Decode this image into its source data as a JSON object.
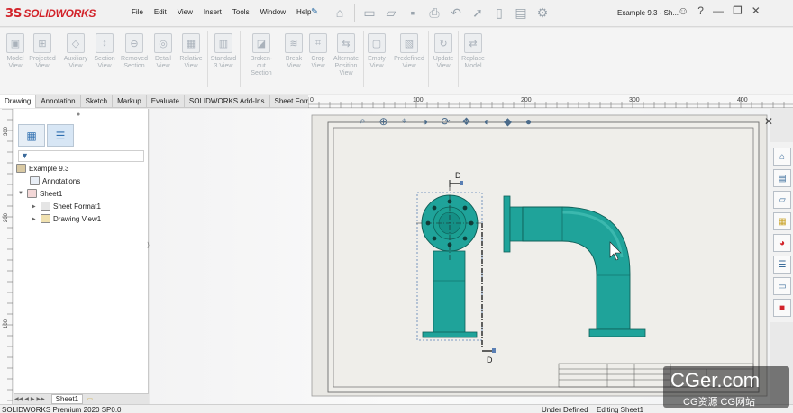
{
  "app": {
    "logo_mark": "3S",
    "logo_text": "SOLIDWORKS",
    "menus": [
      "File",
      "Edit",
      "View",
      "Insert",
      "Tools",
      "Window",
      "Help"
    ],
    "document_title": "Example 9.3 - Sh...",
    "quick_access_icons": [
      "home-icon",
      "new-icon",
      "open-icon",
      "save-icon",
      "print-icon",
      "undo-icon",
      "select-icon",
      "rebuild-icon",
      "file-properties-icon",
      "options-icon"
    ],
    "accent_color": "#d2232a"
  },
  "ribbon": {
    "groups": [
      {
        "label": "Model View"
      },
      {
        "label": "Projected View"
      },
      {
        "label": "Auxiliary View"
      },
      {
        "label": "Section View"
      },
      {
        "label": "Removed Section"
      },
      {
        "label": "Detail View"
      },
      {
        "label": "Relative View"
      },
      {
        "label": "Standard 3 View"
      },
      {
        "label": "Broken-out Section"
      },
      {
        "label": "Break View"
      },
      {
        "label": "Crop View"
      },
      {
        "label": "Alternate Position View"
      },
      {
        "label": "Empty View"
      },
      {
        "label": "Predefined View"
      },
      {
        "label": "Update View"
      },
      {
        "label": "Replace Model"
      }
    ]
  },
  "tabs": [
    "Drawing",
    "Annotation",
    "Sketch",
    "Markup",
    "Evaluate",
    "SOLIDWORKS Add-Ins",
    "Sheet Format"
  ],
  "rulers": {
    "top": [
      "0",
      "100",
      "200",
      "300",
      "400"
    ],
    "left": [
      "300",
      "200",
      "100"
    ]
  },
  "tree": {
    "root": "Example 9.3",
    "annotations": "Annotations",
    "sheet": "Sheet1",
    "sheet_format": "Sheet Format1",
    "drawing_view": "Drawing View1"
  },
  "sheet_tab": "Sheet1",
  "drawing": {
    "section_label_top": "D",
    "section_label_bottom": "D",
    "part_color": "#1fa39a",
    "part_dark": "#0f6f68"
  },
  "status": {
    "product": "SOLIDWORKS Premium 2020 SP0.0",
    "state": "Under Defined",
    "editing": "Editing Sheet1"
  },
  "watermark": {
    "main": "CGer.com",
    "sub": "CG资源 CG网站"
  }
}
